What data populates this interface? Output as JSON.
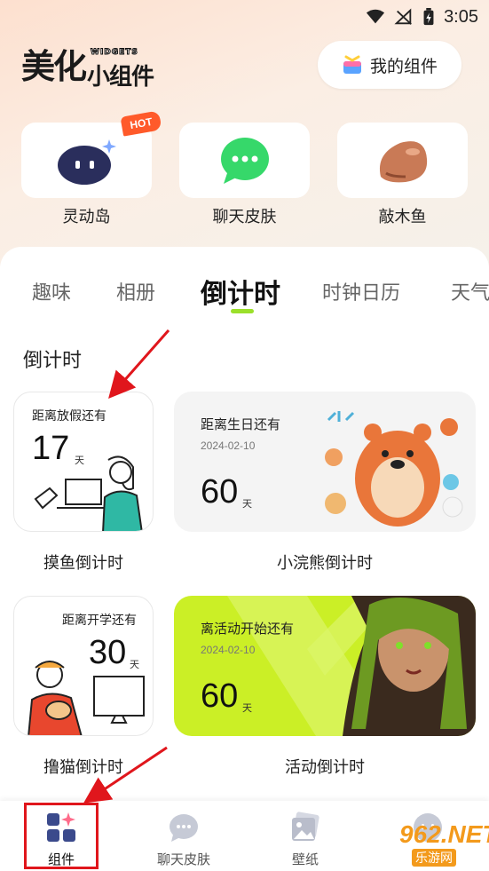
{
  "status_bar": {
    "time": "3:05"
  },
  "header": {
    "brand_main": "美化",
    "brand_tag": "WIDGETS",
    "brand_sub": "小组件",
    "my_widgets_label": "我的组件"
  },
  "quick_entries": [
    {
      "label": "灵动岛",
      "icon": "dynamic-island-icon",
      "badge": "HOT"
    },
    {
      "label": "聊天皮肤",
      "icon": "chat-bubble-icon"
    },
    {
      "label": "敲木鱼",
      "icon": "wooden-fish-icon"
    }
  ],
  "tabs": [
    "趣味",
    "相册",
    "倒计时",
    "时钟日历",
    "天气"
  ],
  "active_tab": "倒计时",
  "section_title": "倒计时",
  "widgets": [
    {
      "title": "距离放假还有",
      "number": "17",
      "unit": "天",
      "label": "摸鱼倒计时"
    },
    {
      "title": "距离生日还有",
      "date": "2024-02-10",
      "number": "60",
      "unit": "天",
      "label": "小浣熊倒计时"
    },
    {
      "title": "距离开学还有",
      "number": "30",
      "unit": "天",
      "label": "撸猫倒计时"
    },
    {
      "title": "离活动开始还有",
      "date": "2024-02-10",
      "number": "60",
      "unit": "天",
      "label": "活动倒计时"
    }
  ],
  "bottom_nav": [
    {
      "label": "组件",
      "icon": "widgets-icon",
      "active": true
    },
    {
      "label": "聊天皮肤",
      "icon": "chat-skin-icon"
    },
    {
      "label": "壁纸",
      "icon": "wallpaper-icon"
    },
    {
      "label": "我的",
      "icon": "profile-icon"
    }
  ],
  "watermark": {
    "main": "962.NET",
    "sub": "乐游网"
  },
  "colors": {
    "accent": "#9be02a",
    "annotation_red": "#e0161c",
    "hot_badge": "#ff5a2a"
  }
}
